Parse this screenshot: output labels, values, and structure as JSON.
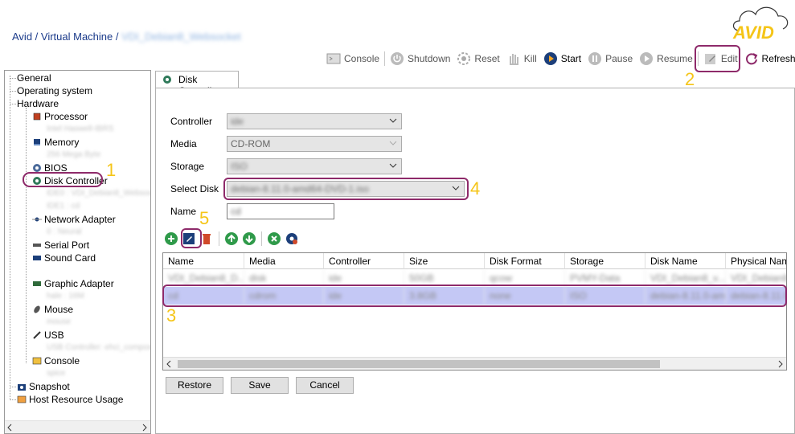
{
  "breadcrumb": {
    "path": "Avid / Virtual Machine / ",
    "vm_name": "VDI_Debian8_Websocket"
  },
  "logo": {
    "text": "AVID"
  },
  "toolbar": {
    "console": "Console",
    "shutdown": "Shutdown",
    "reset": "Reset",
    "kill": "Kill",
    "start": "Start",
    "pause": "Pause",
    "resume": "Resume",
    "edit": "Edit",
    "refresh": "Refresh"
  },
  "tree": {
    "general": "General",
    "os": "Operating system",
    "hardware": "Hardware",
    "processor": "Processor",
    "processor_sub": "Intel Haswell-IBRS",
    "memory": "Memory",
    "memory_sub": "256 Mega Byte",
    "bios": "BIOS",
    "disk_controller": "Disk Controller",
    "disk_sub1": "IDE0 : VDI_Debian8_Websocket",
    "disk_sub2": "IDE1 : cd",
    "network": "Network Adapter",
    "network_sub": "0 : Neural",
    "serial": "Serial Port",
    "sound": "Sound Card",
    "graphic": "Graphic Adapter",
    "graphic_sub": "hale : 16M",
    "mouse": "Mouse",
    "mouse_sub": "mouse",
    "usb": "USB",
    "usb_sub": "USB Controller: ehci_composite",
    "console": "Console",
    "console_sub": "spice",
    "snapshot": "Snapshot",
    "host": "Host Resource Usage"
  },
  "tab": {
    "label": "Disk Controller"
  },
  "form": {
    "controller_label": "Controller",
    "controller_value": "ide",
    "media_label": "Media",
    "media_value": "CD-ROM",
    "storage_label": "Storage",
    "storage_value": "ISO",
    "disk_label": "Select Disk",
    "disk_value": "debian-8.11.0-amd64-DVD-1.iso",
    "name_label": "Name",
    "name_value": "cd"
  },
  "grid": {
    "columns": [
      "Name",
      "Media",
      "Controller",
      "Size",
      "Disk Format",
      "Storage",
      "Disk Name",
      "Physical Name"
    ],
    "rows": [
      [
        "VDI_Debian8_D...",
        "disk",
        "ide",
        "50GB",
        "qcow",
        "PVMY-Data",
        "VDI_Debian8_v...",
        "VDI_Debian8_..."
      ],
      [
        "cd",
        "cdrom",
        "ide",
        "3.8GB",
        "none",
        "ISO",
        "debian-8.11.0-amd...",
        "debian-8.11.0-a..."
      ]
    ]
  },
  "buttons": {
    "restore": "Restore",
    "save": "Save",
    "cancel": "Cancel"
  },
  "annotations": {
    "n1": "1",
    "n2": "2",
    "n3": "3",
    "n4": "4",
    "n5": "5"
  },
  "colors": {
    "highlight": "#8e2a6a",
    "annotation_number": "#f5c518",
    "selected_row": "#c4c8f5"
  }
}
